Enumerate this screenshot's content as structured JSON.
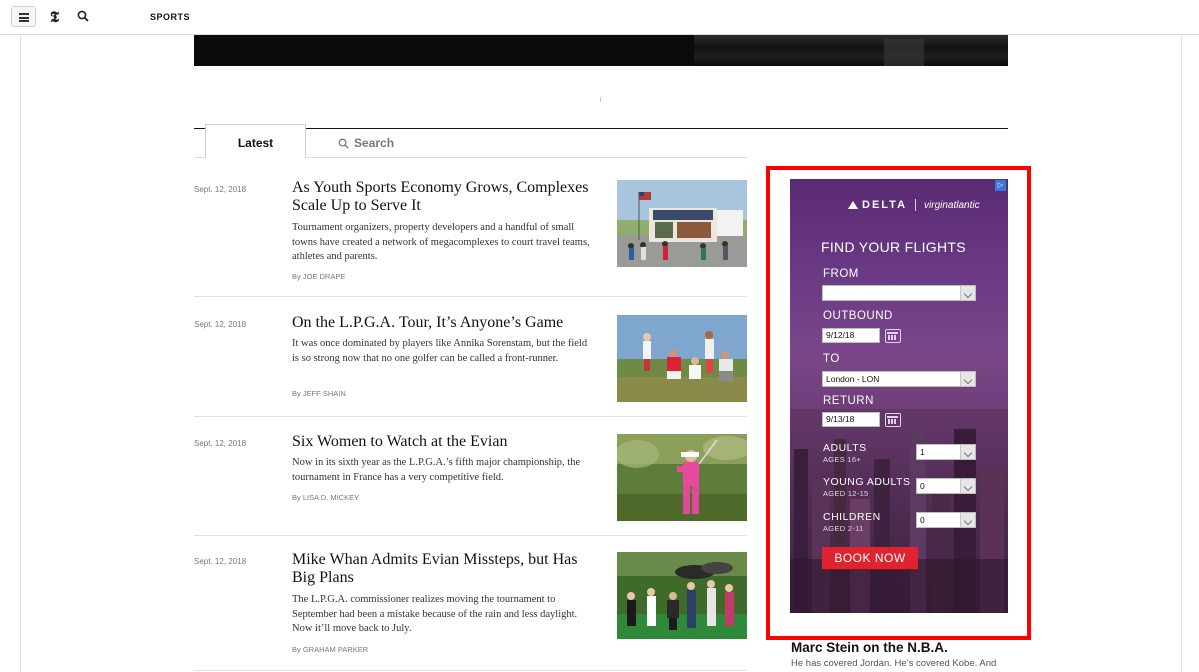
{
  "header": {
    "section": "SPORTS",
    "logo": "𝕿"
  },
  "tabs": {
    "latest": "Latest",
    "search": "Search"
  },
  "articles": [
    {
      "date": "Sept. 12, 2018",
      "title": "As Youth Sports Economy Grows, Complexes Scale Up to Serve It",
      "summary": "Tournament organizers, property developers and a handful of small towns have created a network of megacomplexes to court travel teams, athletes and parents.",
      "byline": "By JOE DRAPE"
    },
    {
      "date": "Sept. 12, 2018",
      "title": "On the L.P.G.A. Tour, It’s Anyone’s Game",
      "summary": "It was once dominated by players like Annika Sorenstam, but the field is so strong now that no one golfer can be called a front-runner.",
      "byline": "By JEFF SHAIN"
    },
    {
      "date": "Sept. 12, 2018",
      "title": "Six Women to Watch at the Evian",
      "summary": "Now in its sixth year as the L.P.G.A.’s fifth major championship, the tournament in France has a very competitive field.",
      "byline": "By LISA D. MICKEY"
    },
    {
      "date": "Sept. 12, 2018",
      "title": "Mike Whan Admits Evian Missteps, but Has Big Plans",
      "summary": "The L.P.G.A. commissioner realizes moving the tournament to September had been a mistake because of the rain and less daylight. Now it’ll move back to July.",
      "byline": "By GRAHAM PARKER"
    }
  ],
  "ad": {
    "delta": "DELTA",
    "virgin": "virginatlantic",
    "heading": "FIND YOUR FLIGHTS",
    "from_label": "FROM",
    "from_value": "",
    "outbound_label": "OUTBOUND",
    "outbound_value": "9/12/18",
    "to_label": "TO",
    "to_value": "London - LON",
    "return_label": "RETURN",
    "return_value": "9/13/18",
    "adults_label": "ADULTS",
    "adults_sub": "AGES 16+",
    "adults_value": "1",
    "young_label": "YOUNG ADULTS",
    "young_sub": "AGED 12-15",
    "young_value": "0",
    "children_label": "CHILDREN",
    "children_sub": "AGED 2-11",
    "children_value": "0",
    "book_label": "BOOK NOW",
    "adchoices": "▷"
  },
  "sidebar": {
    "title": "Marc Stein on the N.B.A.",
    "summary": "He has covered Jordan. He’s covered Kobe. And"
  }
}
